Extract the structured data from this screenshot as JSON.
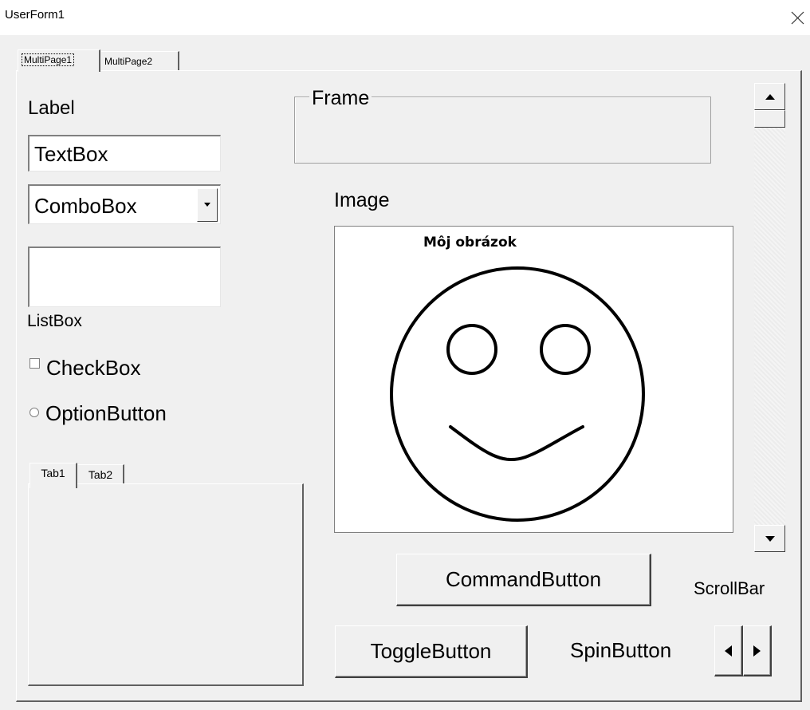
{
  "window": {
    "title": "UserForm1",
    "close_icon": "close-icon"
  },
  "multipage": {
    "tabs": [
      "MultiPage1",
      "MultiPage2"
    ],
    "active_tab": "MultiPage1"
  },
  "controls": {
    "label": "Label",
    "textbox_value": "TextBox",
    "combobox_value": "ComboBox",
    "listbox_label": "ListBox",
    "checkbox_label": "CheckBox",
    "optionbutton_label": "OptionButton",
    "frame_caption": "Frame",
    "image_label": "Image",
    "image_caption": "Môj obrázok",
    "scrollbar_label": "ScrollBar",
    "command_button": "CommandButton",
    "toggle_button": "ToggleButton",
    "spinbutton_label": "SpinButton"
  },
  "tabstrip": {
    "tabs": [
      "Tab1",
      "Tab2"
    ],
    "active_tab": "Tab1"
  },
  "colors": {
    "form_background": "#f0f0f0",
    "control_background": "#ffffff",
    "shadow": "#606060"
  }
}
